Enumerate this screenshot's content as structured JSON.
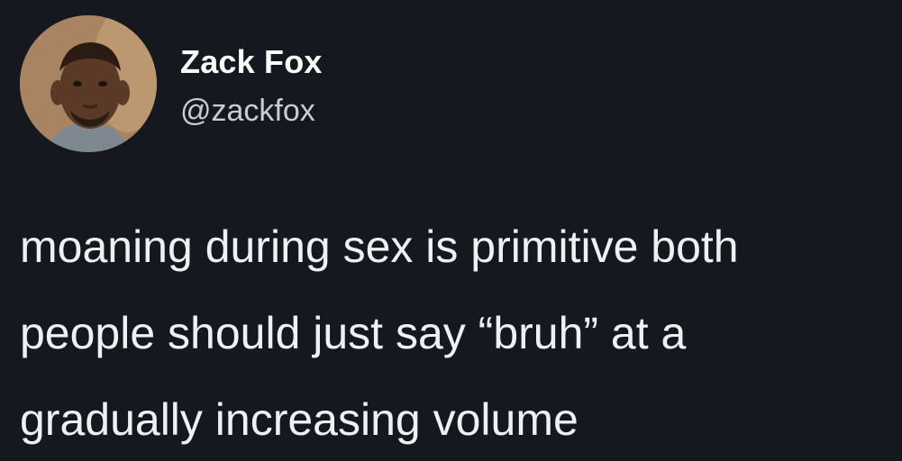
{
  "tweet": {
    "author": {
      "name": "Zack Fox",
      "handle": "@zackfox",
      "avatar_icon": "profile-photo"
    },
    "text_lines": [
      "moaning during sex is primitive both",
      "people should just say “bruh” at a",
      "gradually increasing volume"
    ]
  },
  "colors": {
    "background": "#15181f",
    "name": "#ffffff",
    "handle": "#c9ccd2",
    "text": "#eef0f3"
  }
}
